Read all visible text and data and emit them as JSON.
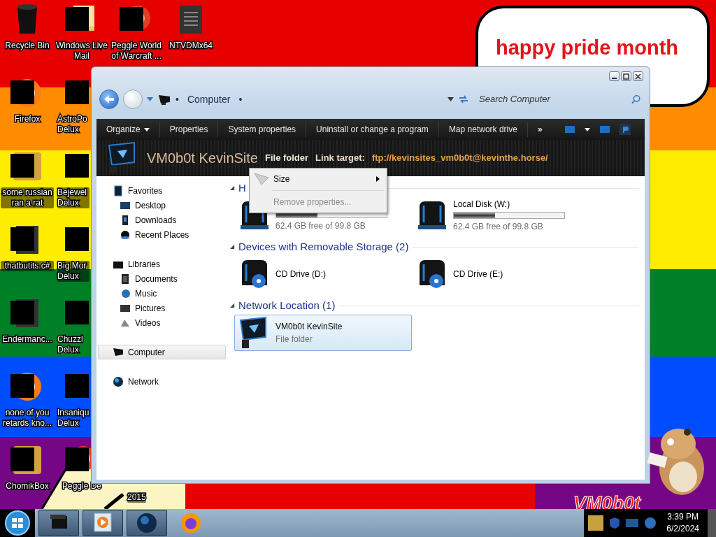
{
  "desktop": {
    "columns": [
      {
        "icons": [
          {
            "label": "Recycle Bin",
            "kind": "bin",
            "redacted": false,
            "covered": false
          },
          {
            "label": "Firefox",
            "kind": "browser",
            "redacted": true,
            "covered": false
          },
          {
            "label": "some russian ran a rat",
            "kind": "app",
            "redacted": true,
            "covered": false
          },
          {
            "label": "thatbutits.c#",
            "kind": "file",
            "redacted": true,
            "covered": false
          },
          {
            "label": "Endermanc...",
            "kind": "file",
            "redacted": true,
            "covered": false
          },
          {
            "label": "none of you retards kno...",
            "kind": "browser",
            "redacted": true,
            "covered": false
          },
          {
            "label": "ChomikBox",
            "kind": "app",
            "redacted": true,
            "covered": false
          }
        ]
      },
      {
        "icons": [
          {
            "label": "Windows Live Mail",
            "kind": "mail",
            "redacted": true,
            "covered": false
          },
          {
            "label": "AstroPo Delux",
            "kind": "game",
            "redacted": true,
            "covered": true
          },
          {
            "label": "Bejewel Delux",
            "kind": "game",
            "redacted": true,
            "covered": true
          },
          {
            "label": "Big Mor Delux",
            "kind": "game",
            "redacted": true,
            "covered": true
          },
          {
            "label": "Chuzzl Delux",
            "kind": "game",
            "redacted": true,
            "covered": true
          },
          {
            "label": "Insaniqu Delux",
            "kind": "game",
            "redacted": true,
            "covered": true
          },
          {
            "label": "Peggle De",
            "kind": "game",
            "redacted": true,
            "covered": false
          }
        ]
      },
      {
        "icons": [
          {
            "label": "Peggle World of Warcraft ...",
            "kind": "game",
            "redacted": true,
            "covered": false
          },
          {
            "label": "2015",
            "kind": "hidden",
            "redacted": false,
            "covered": true
          }
        ]
      },
      {
        "icons": [
          {
            "label": "NTVDMx64",
            "kind": "file",
            "redacted": false,
            "covered": false
          }
        ]
      }
    ],
    "bubble": "happy pride month",
    "wallpaper_text": "VM0b0t"
  },
  "window": {
    "address": {
      "separator_before": "•",
      "path": "Computer",
      "separator_after": "•"
    },
    "search": {
      "placeholder": "Search Computer"
    },
    "toolbar": [
      {
        "label": "Organize",
        "dropdown": true
      },
      {
        "label": "Properties",
        "dropdown": false
      },
      {
        "label": "System properties",
        "dropdown": false
      },
      {
        "label": "Uninstall or change a program",
        "dropdown": false
      },
      {
        "label": "Map network drive",
        "dropdown": false
      }
    ],
    "toolbar_more": "»",
    "details": {
      "name": "VM0b0t KevinSite",
      "type": "File folder",
      "link_label": "Link target:",
      "link_target": "ftp://kevinsites_vm0b0t@kevinthe.horse/"
    },
    "sidebar": [
      {
        "label": "Favorites",
        "selected": false,
        "children": [
          {
            "label": "Desktop",
            "selected": false
          },
          {
            "label": "Downloads",
            "selected": false
          },
          {
            "label": "Recent Places",
            "selected": false
          }
        ]
      },
      {
        "label": "Libraries",
        "selected": false,
        "children": [
          {
            "label": "Documents",
            "selected": false
          },
          {
            "label": "Music",
            "selected": false
          },
          {
            "label": "Pictures",
            "selected": false
          },
          {
            "label": "Videos",
            "selected": false
          }
        ]
      },
      {
        "label": "Computer",
        "selected": true
      },
      {
        "label": "Network",
        "selected": false
      }
    ],
    "groups": [
      {
        "toggle": "◢",
        "title": "H",
        "items": [
          {
            "kind": "disk",
            "level": 0.375,
            "free": "62.4 GB free of 99.8 GB",
            "selected": false
          },
          {
            "kind": "disk",
            "name": "Local Disk (W:)",
            "level": 0.375,
            "free": "62.4 GB free of 99.8 GB",
            "selected": false
          }
        ]
      },
      {
        "toggle": "◢",
        "title": "Devices with Removable Storage (2)",
        "items": [
          {
            "kind": "cd",
            "name": "CD Drive (D:)",
            "selected": false
          },
          {
            "kind": "cd",
            "name": "CD Drive (E:)",
            "selected": false
          }
        ]
      },
      {
        "toggle": "◢",
        "title": "Network Location (1)",
        "items": [
          {
            "kind": "folder",
            "name": "VM0b0t KevinSite",
            "type": "File folder",
            "selected": true
          }
        ]
      }
    ],
    "context_menu": [
      {
        "label": "Size",
        "submenu": true,
        "disabled": false
      },
      {
        "label": "Remove properties...",
        "submenu": false,
        "disabled": true
      }
    ]
  },
  "taskbar": {
    "buttons": [
      {
        "kind": "explorer",
        "open": true
      },
      {
        "kind": "media",
        "open": true
      },
      {
        "kind": "globe",
        "open": true
      },
      {
        "kind": "firefox",
        "open": false
      }
    ],
    "clock": {
      "time": "3:39 PM",
      "date": "6/2/2024"
    }
  }
}
